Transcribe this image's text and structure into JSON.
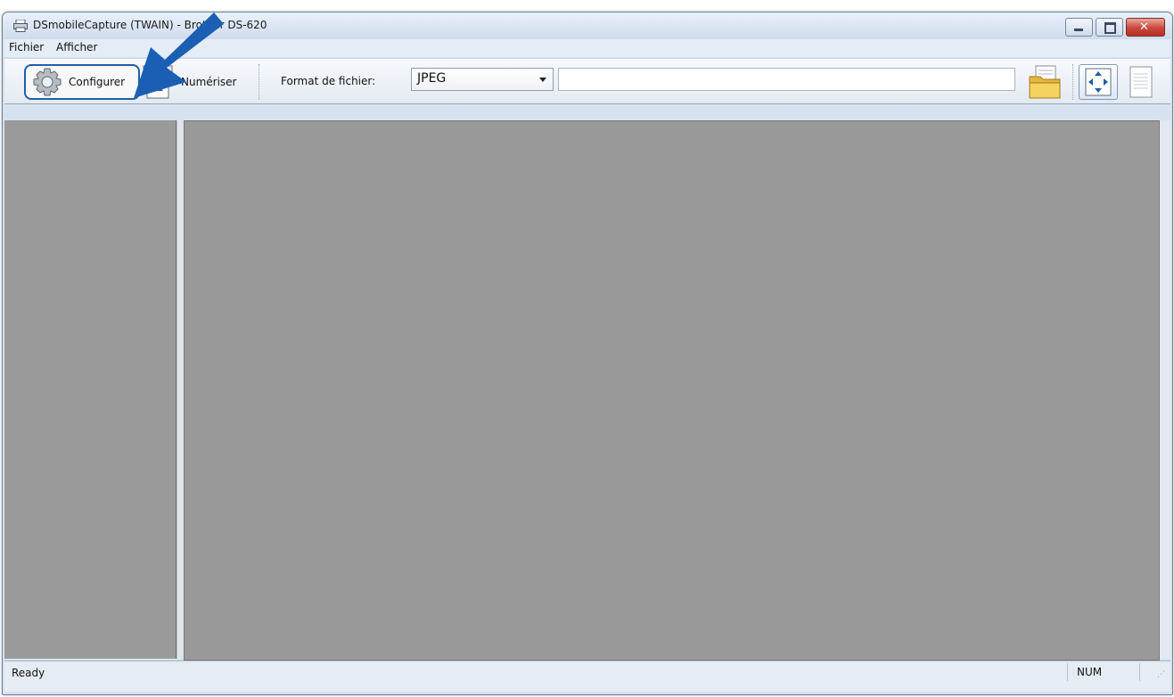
{
  "window": {
    "title": "DSmobileCapture (TWAIN) - Brother DS-620",
    "app_icon": "printer-icon",
    "controls": {
      "minimize": "minimize-icon",
      "maximize": "maximize-icon",
      "close": "close-icon"
    }
  },
  "menu": {
    "items": [
      "Fichier",
      "Afficher"
    ]
  },
  "toolbar": {
    "configure_label": "Configurer",
    "configure_icon": "gear-icon",
    "scan_label": "Numériser",
    "scan_icon": "scanner-icon",
    "format_label": "Format de fichier:",
    "format_value": "JPEG",
    "path_value": "",
    "folder_icon": "folder-icon",
    "fit_icon": "fit-to-window-icon",
    "page_icon": "page-view-icon"
  },
  "status": {
    "text": "Ready",
    "num": "NUM"
  },
  "annotation": {
    "arrow_color": "#1a5fb4",
    "highlight_color": "#1f5fa8"
  }
}
